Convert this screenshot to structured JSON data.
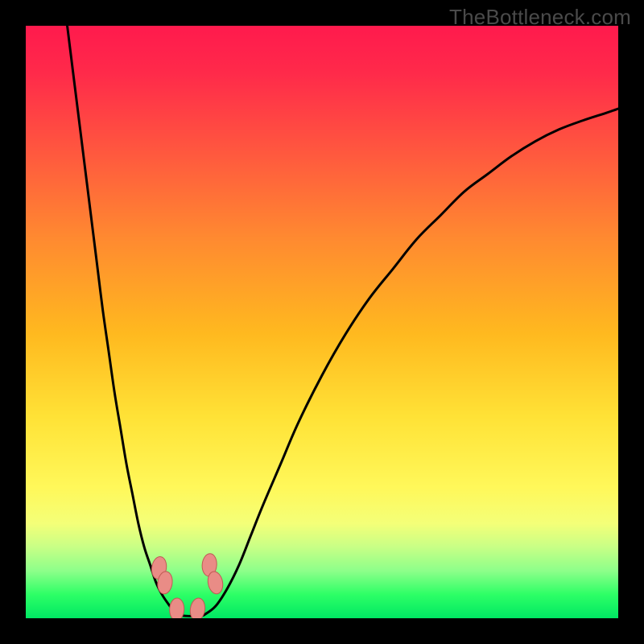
{
  "watermark": "TheBottleneck.com",
  "chart_data": {
    "type": "line",
    "title": "",
    "xlabel": "",
    "ylabel": "",
    "xlim": [
      0,
      100
    ],
    "ylim": [
      0,
      100
    ],
    "series": [
      {
        "name": "left-curve",
        "x": [
          7,
          8,
          9,
          10,
          11,
          12,
          13,
          14,
          15,
          16,
          17,
          18,
          19,
          20,
          21,
          22,
          23,
          24,
          25,
          26
        ],
        "values": [
          100,
          92,
          84,
          76,
          68,
          60,
          52,
          45,
          38,
          32,
          26,
          21,
          16,
          12,
          9,
          6,
          4,
          2.5,
          1.2,
          0.5
        ]
      },
      {
        "name": "right-curve",
        "x": [
          30,
          32,
          34,
          36,
          38,
          40,
          43,
          46,
          50,
          54,
          58,
          62,
          66,
          70,
          74,
          78,
          82,
          86,
          90,
          94,
          98,
          100
        ],
        "values": [
          0.5,
          2,
          5,
          9,
          14,
          19,
          26,
          33,
          41,
          48,
          54,
          59,
          64,
          68,
          72,
          75,
          78,
          80.5,
          82.5,
          84,
          85.3,
          86
        ]
      }
    ],
    "markers": [
      {
        "x": 22.5,
        "y": 8.5
      },
      {
        "x": 23.5,
        "y": 6.0
      },
      {
        "x": 31.0,
        "y": 9.0
      },
      {
        "x": 32.0,
        "y": 6.0
      },
      {
        "x": 25.5,
        "y": 1.5
      },
      {
        "x": 29.0,
        "y": 1.5
      }
    ],
    "colors": {
      "curve": "#000000",
      "marker_fill": "#e98c86",
      "marker_stroke": "#bf5a54",
      "top": "#ff1a4d",
      "bottom": "#00e763"
    }
  }
}
